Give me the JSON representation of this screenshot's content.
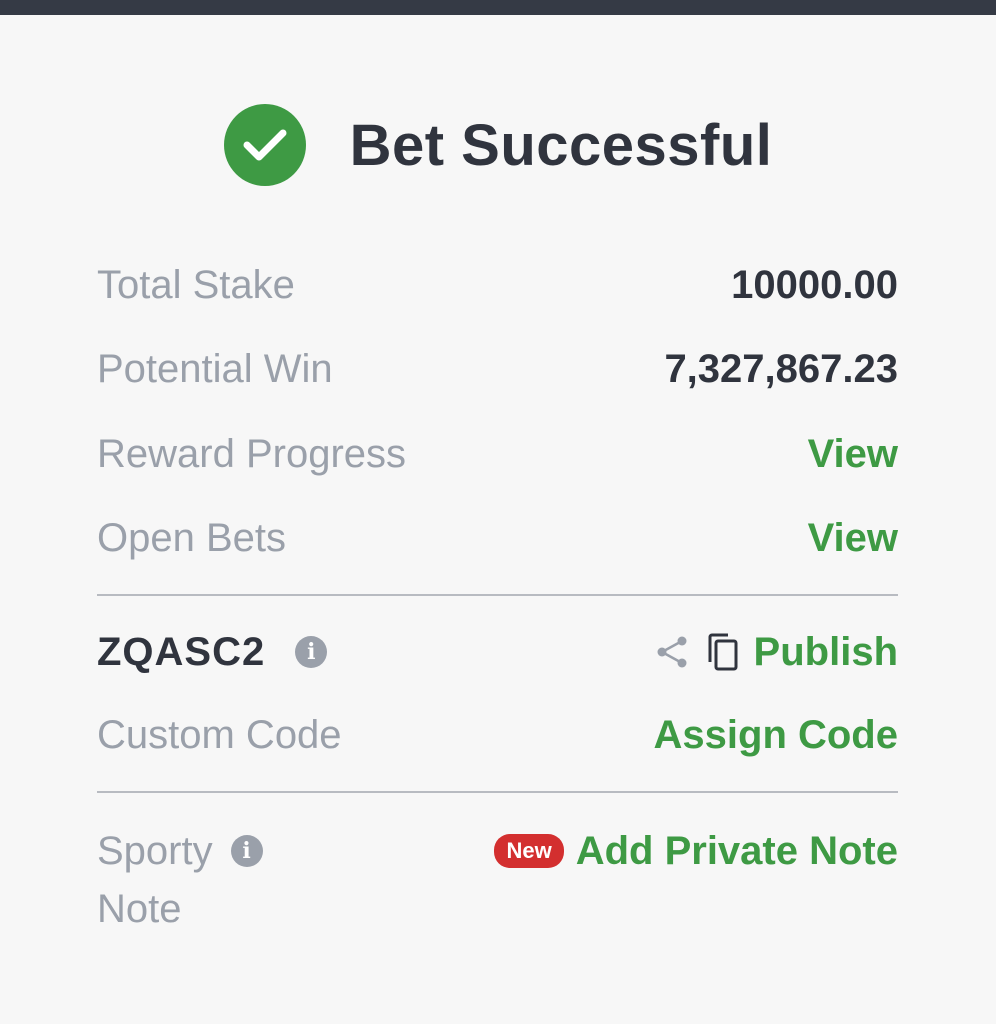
{
  "header": {
    "title": "Bet Successful"
  },
  "summary": {
    "total_stake_label": "Total Stake",
    "total_stake_value": "10000.00",
    "potential_win_label": "Potential Win",
    "potential_win_value": "7,327,867.23",
    "reward_progress_label": "Reward Progress",
    "reward_progress_link": "View",
    "open_bets_label": "Open Bets",
    "open_bets_link": "View"
  },
  "booking": {
    "code": "ZQASC2",
    "publish_label": "Publish",
    "custom_code_label": "Custom Code",
    "assign_code_label": "Assign Code"
  },
  "note": {
    "label_line1": "Sporty",
    "label_line2": "Note",
    "badge": "New",
    "add_label": "Add Private Note"
  },
  "colors": {
    "accent_green": "#3e9a44",
    "text_dark": "#30343e",
    "text_muted": "#9aa0aa",
    "badge_red": "#d32f2f",
    "top_bar": "#353a45"
  },
  "icons": {
    "success": "check-circle-icon",
    "info": "info-icon",
    "share": "share-icon",
    "copy": "copy-icon"
  }
}
